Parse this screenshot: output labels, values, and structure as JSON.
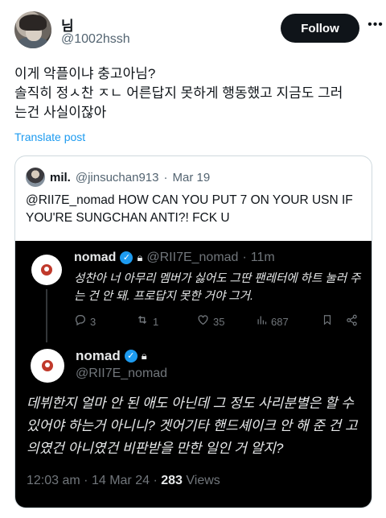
{
  "tweet": {
    "author_name": "님",
    "author_handle": "@1002hssh",
    "follow_label": "Follow",
    "more_label": "•••",
    "lines": [
      "이게 악플이냐 충고아님?",
      "솔직히 정ㅅ찬 ㅈㄴ 어른답지 못하게 행동했고 지금도 그러",
      "는건 사실이잖아"
    ],
    "translate_label": "Translate post"
  },
  "quote": {
    "name": "mil.",
    "handle": "@jinsuchan913",
    "separator": "·",
    "date": "Mar 19",
    "text": "@RII7E_nomad HOW CAN YOU PUT 7 ON YOUR USN IF YOU'RE SUNGCHAN ANTI?! FCK U"
  },
  "screenshot": {
    "reply1": {
      "name": "nomad",
      "handle": "@RII7E_nomad",
      "separator": "·",
      "time": "11m",
      "text": "성찬아 너 아무리 멤버가 싫어도 그딴 팬레터에 하트 눌러 주는 건 안 돼. 프로답지 못한 거야 그거.",
      "replies": "3",
      "reposts": "1",
      "likes": "35",
      "views": "687"
    },
    "reply2": {
      "name": "nomad",
      "handle": "@RII7E_nomad",
      "text": "데뷔한지 얼마 안 된 애도 아닌데 그 정도 사리분별은 할 수 있어야 하는거 아니니? 겟어기타 핸드셰이크 안 해 준 건 고의였건 아니였건 비판받을 만한 일인 거 알지?",
      "time": "12:03 am",
      "separator": "·",
      "date": "14 Mar 24",
      "views_count": "283",
      "views_label": "Views"
    }
  },
  "icons": {
    "verified": "verified-badge-icon",
    "lock": "lock-icon",
    "reply": "reply-icon",
    "repost": "repost-icon",
    "like": "heart-icon",
    "views": "views-icon",
    "bookmark": "bookmark-icon",
    "share": "share-icon"
  },
  "colors": {
    "accent": "#1d9bf0",
    "follow_bg": "#0f1419",
    "dark_bg": "#000000",
    "muted": "#536471"
  }
}
